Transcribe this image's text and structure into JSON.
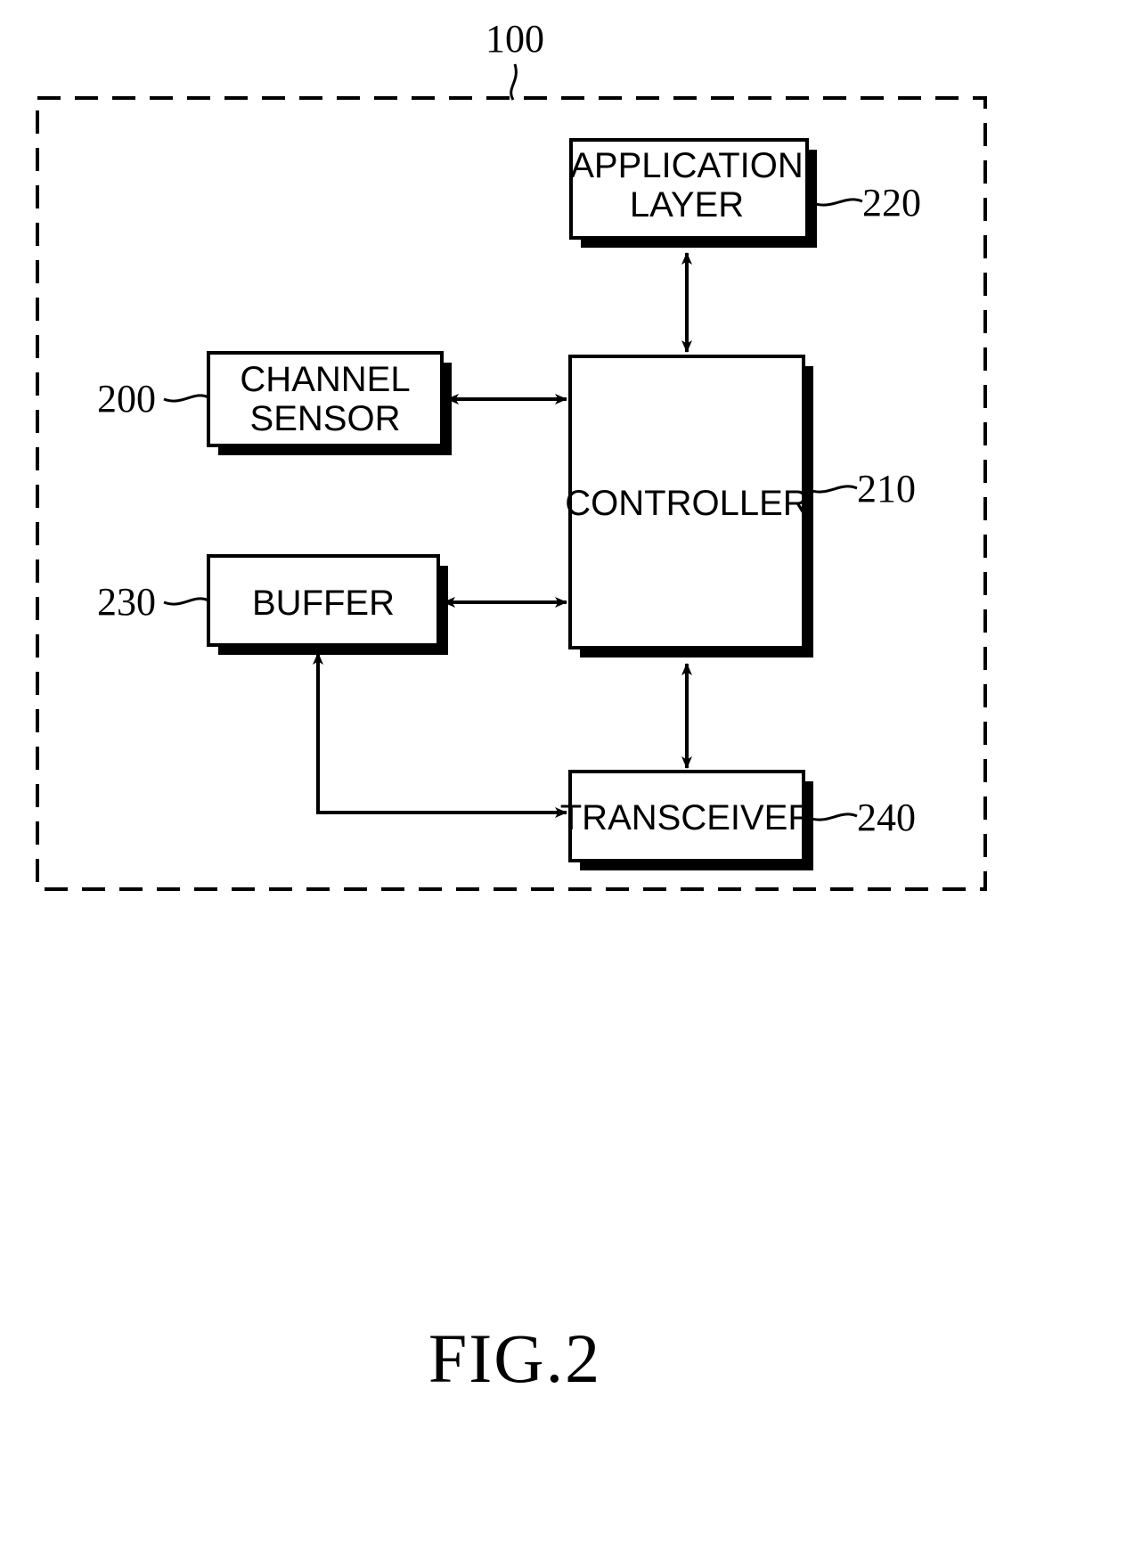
{
  "figure": {
    "caption": "FIG.2",
    "system_ref": "100"
  },
  "blocks": [
    {
      "id": "application-layer",
      "lines": [
        "APPLICATION",
        "LAYER"
      ],
      "ref": "220"
    },
    {
      "id": "channel-sensor",
      "lines": [
        "CHANNEL",
        "SENSOR"
      ],
      "ref": "200"
    },
    {
      "id": "controller",
      "lines": [
        "CONTROLLER"
      ],
      "ref": "210"
    },
    {
      "id": "buffer",
      "lines": [
        "BUFFER"
      ],
      "ref": "230"
    },
    {
      "id": "transceiver",
      "lines": [
        "TRANSCEIVER"
      ],
      "ref": "240"
    }
  ],
  "colors": {
    "ink": "#000000",
    "paper": "#ffffff"
  }
}
